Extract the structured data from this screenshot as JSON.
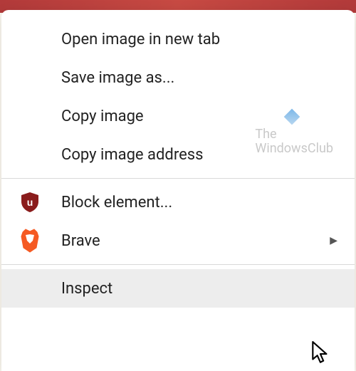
{
  "menu": {
    "items": [
      {
        "label": "Open image in new tab",
        "icon": null,
        "submenu": false
      },
      {
        "label": "Save image as...",
        "icon": null,
        "submenu": false
      },
      {
        "label": "Copy image",
        "icon": null,
        "submenu": false
      },
      {
        "label": "Copy image address",
        "icon": null,
        "submenu": false
      }
    ],
    "extension_items": [
      {
        "label": "Block element...",
        "icon": "ublock-icon",
        "submenu": false
      },
      {
        "label": "Brave",
        "icon": "brave-icon",
        "submenu": true
      }
    ],
    "bottom_items": [
      {
        "label": "Inspect",
        "icon": null,
        "submenu": false,
        "hovered": true
      }
    ]
  },
  "watermark": {
    "line1": "The",
    "line2": "WindowsClub"
  }
}
